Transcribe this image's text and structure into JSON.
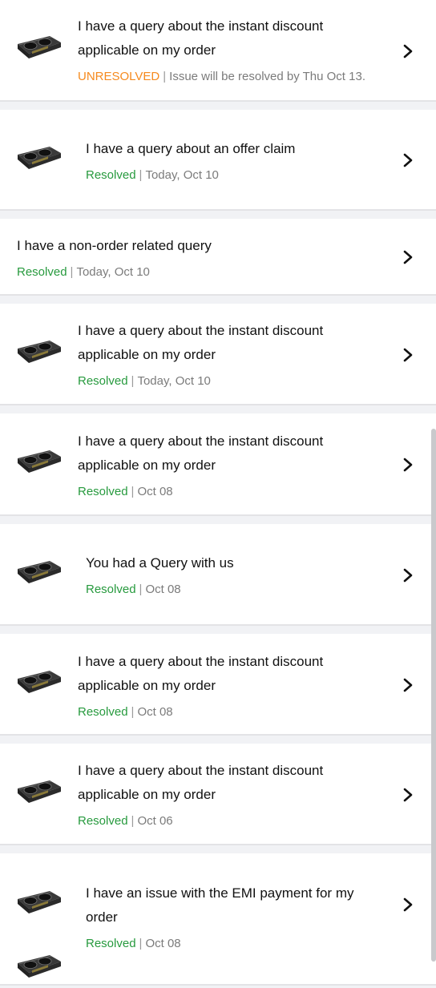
{
  "tickets": [
    {
      "title": "I have a query about the instant discount applicable on my order",
      "status": "UNRESOLVED",
      "status_type": "unresolved",
      "sep": "|",
      "date": "Issue will be resolved by Thu Oct 13.",
      "has_image": true
    },
    {
      "title": "I have a query about an offer claim",
      "status": "Resolved",
      "status_type": "resolved",
      "sep": "|",
      "date": "Today, Oct 10",
      "has_image": true
    },
    {
      "title": "I have a non-order related query",
      "status": "Resolved",
      "status_type": "resolved",
      "sep": "|",
      "date": "Today, Oct 10",
      "has_image": false
    },
    {
      "title": "I have a query about the instant discount applicable on my order",
      "status": "Resolved",
      "status_type": "resolved",
      "sep": "|",
      "date": "Today, Oct 10",
      "has_image": true
    },
    {
      "title": "I have a query about the instant discount applicable on my order",
      "status": "Resolved",
      "status_type": "resolved",
      "sep": "|",
      "date": "Oct 08",
      "has_image": true
    },
    {
      "title": "You had a Query with us",
      "status": "Resolved",
      "status_type": "resolved",
      "sep": "|",
      "date": "Oct 08",
      "has_image": true
    },
    {
      "title": "I have a query about the instant discount applicable on my order",
      "status": "Resolved",
      "status_type": "resolved",
      "sep": "|",
      "date": "Oct 08",
      "has_image": true
    },
    {
      "title": "I have a query about the instant discount applicable on my order",
      "status": "Resolved",
      "status_type": "resolved",
      "sep": "|",
      "date": "Oct 06",
      "has_image": true
    },
    {
      "title": "I have an issue with the EMI payment for my order",
      "status": "Resolved",
      "status_type": "resolved",
      "sep": "|",
      "date": "Oct 08",
      "has_image": true
    },
    {
      "title": "",
      "status": "",
      "status_type": "resolved",
      "sep": "",
      "date": "",
      "has_image": true
    }
  ],
  "icons": {
    "product": "graphics-card-product-image",
    "chevron": "chevron-right-icon"
  },
  "colors": {
    "unresolved": "#f68a1e",
    "resolved": "#279a3e",
    "background": "#f1f2f5"
  }
}
